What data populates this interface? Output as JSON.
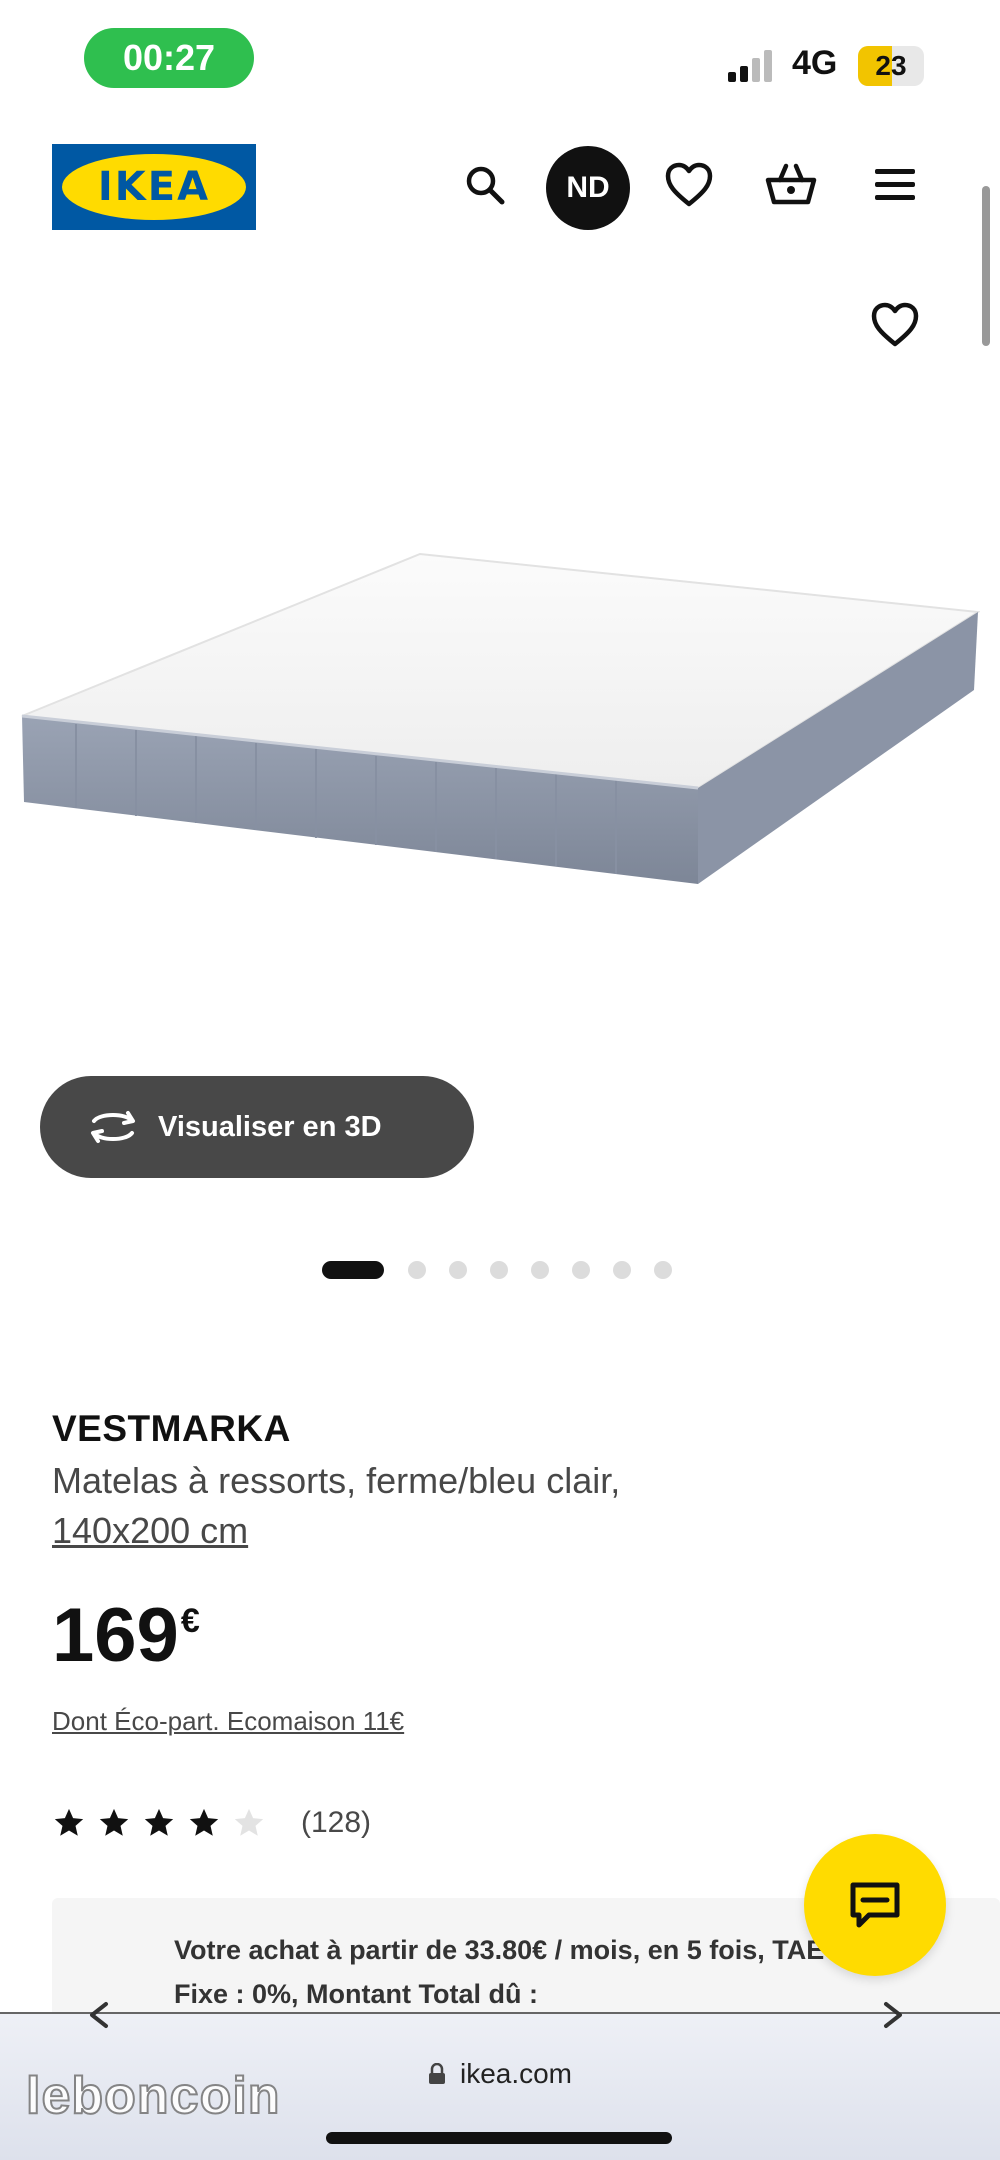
{
  "status_bar": {
    "time": "00:27",
    "network": "4G",
    "battery": "23"
  },
  "header": {
    "logo_text": "IKEA",
    "avatar_initials": "ND"
  },
  "gallery": {
    "view3d_label": "Visualiser en 3D",
    "dot_count": 8,
    "active_dot": 0
  },
  "product": {
    "name": "VESTMARKA",
    "description": "Matelas à ressorts, ferme/bleu clair,",
    "size": "140x200 cm",
    "price": "169",
    "currency": "€",
    "eco_participation": "Dont Éco-part. Ecomaison 11€",
    "rating": 4,
    "rating_max": 5,
    "review_count": "(128)"
  },
  "financing": {
    "text": "Votre achat à partir de 33.80€ / mois, en 5 fois, TAEG Fixe : 0%, Montant Total dû :"
  },
  "browser": {
    "url": "ikea.com"
  },
  "watermark": "leboncoin",
  "colors": {
    "ikea_blue": "#0058a3",
    "ikea_yellow": "#ffdb00",
    "time_pill": "#2fbf4f",
    "button_dark": "#484848"
  },
  "icons": {
    "search": "search-icon",
    "wishlist": "heart-icon",
    "cart": "basket-icon",
    "menu": "hamburger-menu-icon",
    "chat": "chat-bubble-icon",
    "rotate3d": "rotate-3d-icon"
  }
}
